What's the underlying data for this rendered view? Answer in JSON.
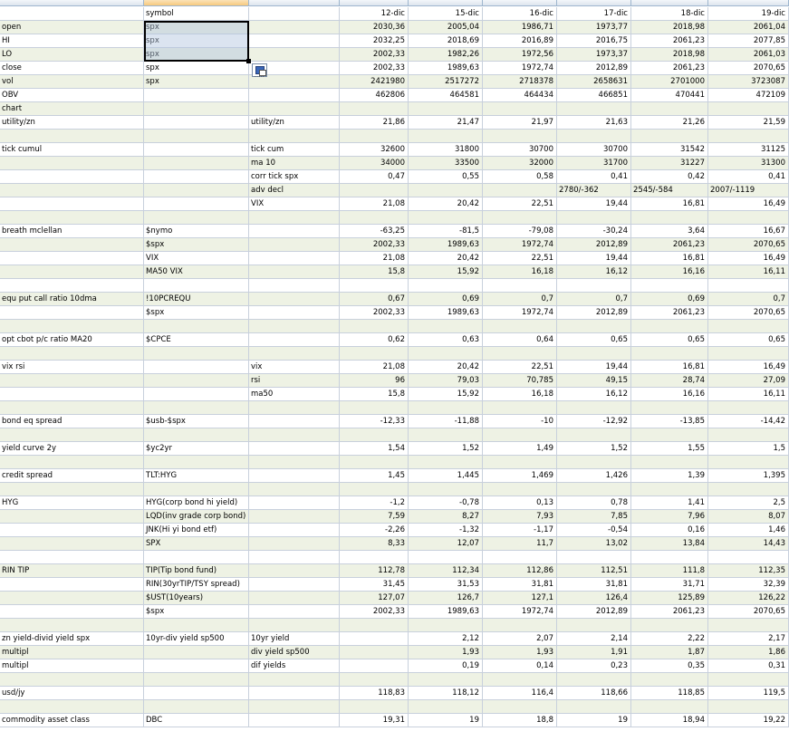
{
  "headers": {
    "symbol": "symbol",
    "dates": [
      "12-dic",
      "15-dic",
      "16-dic",
      "17-dic",
      "18-dic",
      "19-dic"
    ]
  },
  "rows": [
    [
      "open",
      "spx",
      "",
      "2030,36",
      "2005,04",
      "1986,71",
      "1973,77",
      "2018,98",
      "2061,04"
    ],
    [
      "HI",
      "spx",
      "",
      "2032,25",
      "2018,69",
      "2016,89",
      "2016,75",
      "2061,23",
      "2077,85"
    ],
    [
      "LO",
      "spx",
      "",
      "2002,33",
      "1982,26",
      "1972,56",
      "1973,37",
      "2018,98",
      "2061,03"
    ],
    [
      "close",
      "spx",
      "",
      "2002,33",
      "1989,63",
      "1972,74",
      "2012,89",
      "2061,23",
      "2070,65"
    ],
    [
      "vol",
      "spx",
      "",
      "2421980",
      "2517272",
      "2718378",
      "2658631",
      "2701000",
      "3723087"
    ],
    [
      "OBV",
      "",
      "",
      "462806",
      "464581",
      "464434",
      "466851",
      "470441",
      "472109"
    ],
    [
      "chart",
      "",
      "",
      "",
      "",
      "",
      "",
      "",
      ""
    ],
    [
      "utility/zn",
      "",
      "utility/zn",
      "21,86",
      "21,47",
      "21,97",
      "21,63",
      "21,26",
      "21,59"
    ],
    [
      "",
      "",
      "",
      "",
      "",
      "",
      "",
      "",
      ""
    ],
    [
      "tick cumul",
      "",
      "tick cum",
      "32600",
      "31800",
      "30700",
      "30700",
      "31542",
      "31125"
    ],
    [
      "",
      "",
      "ma 10",
      "34000",
      "33500",
      "32000",
      "31700",
      "31227",
      "31300"
    ],
    [
      "",
      "",
      "corr tick spx",
      "0,47",
      "0,55",
      "0,58",
      "0,41",
      "0,42",
      "0,41"
    ],
    [
      "",
      "",
      "adv decl",
      "",
      "",
      "",
      "2780/-362",
      "2545/-584",
      "2007/-1119"
    ],
    [
      "",
      "",
      "VIX",
      "21,08",
      "20,42",
      "22,51",
      "19,44",
      "16,81",
      "16,49"
    ],
    [
      "",
      "",
      "",
      "",
      "",
      "",
      "",
      "",
      ""
    ],
    [
      "breath mclellan",
      "$nymo",
      "",
      "-63,25",
      "-81,5",
      "-79,08",
      "-30,24",
      "3,64",
      "16,67"
    ],
    [
      "",
      "$spx",
      "",
      "2002,33",
      "1989,63",
      "1972,74",
      "2012,89",
      "2061,23",
      "2070,65"
    ],
    [
      "",
      "VIX",
      "",
      "21,08",
      "20,42",
      "22,51",
      "19,44",
      "16,81",
      "16,49"
    ],
    [
      "",
      "MA50 VIX",
      "",
      "15,8",
      "15,92",
      "16,18",
      "16,12",
      "16,16",
      "16,11"
    ],
    [
      "",
      "",
      "",
      "",
      "",
      "",
      "",
      "",
      ""
    ],
    [
      "equ put call ratio 10dma",
      "!10PCREQU",
      "",
      "0,67",
      "0,69",
      "0,7",
      "0,7",
      "0,69",
      "0,7"
    ],
    [
      "",
      "$spx",
      "",
      "2002,33",
      "1989,63",
      "1972,74",
      "2012,89",
      "2061,23",
      "2070,65"
    ],
    [
      "",
      "",
      "",
      "",
      "",
      "",
      "",
      "",
      ""
    ],
    [
      "opt cbot p/c ratio MA20",
      "$CPCE",
      "",
      "0,62",
      "0,63",
      "0,64",
      "0,65",
      "0,65",
      "0,65"
    ],
    [
      "",
      "",
      "",
      "",
      "",
      "",
      "",
      "",
      ""
    ],
    [
      "vix rsi",
      "",
      "vix",
      "21,08",
      "20,42",
      "22,51",
      "19,44",
      "16,81",
      "16,49"
    ],
    [
      "",
      "",
      "rsi",
      "96",
      "79,03",
      "70,785",
      "49,15",
      "28,74",
      "27,09"
    ],
    [
      "",
      "",
      "ma50",
      "15,8",
      "15,92",
      "16,18",
      "16,12",
      "16,16",
      "16,11"
    ],
    [
      "",
      "",
      "",
      "",
      "",
      "",
      "",
      "",
      ""
    ],
    [
      "bond eq spread",
      "$usb-$spx",
      "",
      "-12,33",
      "-11,88",
      "-10",
      "-12,92",
      "-13,85",
      "-14,42"
    ],
    [
      "",
      "",
      "",
      "",
      "",
      "",
      "",
      "",
      ""
    ],
    [
      "yield curve 2y",
      "$yc2yr",
      "",
      "1,54",
      "1,52",
      "1,49",
      "1,52",
      "1,55",
      "1,5"
    ],
    [
      "",
      "",
      "",
      "",
      "",
      "",
      "",
      "",
      ""
    ],
    [
      "credit spread",
      "TLT:HYG",
      "",
      "1,45",
      "1,445",
      "1,469",
      "1,426",
      "1,39",
      "1,395"
    ],
    [
      "",
      "",
      "",
      "",
      "",
      "",
      "",
      "",
      ""
    ],
    [
      "HYG",
      "HYG(corp bond hi yield)",
      "",
      "-1,2",
      "-0,78",
      "0,13",
      "0,78",
      "1,41",
      "2,5"
    ],
    [
      "",
      "LQD(inv grade corp bond)",
      "",
      "7,59",
      "8,27",
      "7,93",
      "7,85",
      "7,96",
      "8,07"
    ],
    [
      "",
      "JNK(Hi yi bond etf)",
      "",
      "-2,26",
      "-1,32",
      "-1,17",
      "-0,54",
      "0,16",
      "1,46"
    ],
    [
      "",
      "SPX",
      "",
      "8,33",
      "12,07",
      "11,7",
      "13,02",
      "13,84",
      "14,43"
    ],
    [
      "",
      "",
      "",
      "",
      "",
      "",
      "",
      "",
      ""
    ],
    [
      "RIN TIP",
      "TIP(Tip bond fund)",
      "",
      "112,78",
      "112,34",
      "112,86",
      "112,51",
      "111,8",
      "112,35"
    ],
    [
      "",
      "RIN(30yrTIP/TSY spread)",
      "",
      "31,45",
      "31,53",
      "31,81",
      "31,81",
      "31,71",
      "32,39"
    ],
    [
      "",
      "$UST(10years)",
      "",
      "127,07",
      "126,7",
      "127,1",
      "126,4",
      "125,89",
      "126,22"
    ],
    [
      "",
      "$spx",
      "",
      "2002,33",
      "1989,63",
      "1972,74",
      "2012,89",
      "2061,23",
      "2070,65"
    ],
    [
      "",
      "",
      "",
      "",
      "",
      "",
      "",
      "",
      ""
    ],
    [
      "zn yield-divid yield spx",
      "10yr-div yield sp500",
      "10yr yield",
      "2,12",
      "2,07",
      "2,14",
      "2,22",
      "2,17"
    ],
    [
      "multipl",
      "",
      "div yield sp500",
      "1,93",
      "1,93",
      "1,91",
      "1,87",
      "1,86"
    ],
    [
      "multipl",
      "",
      "dif yields",
      "0,19",
      "0,14",
      "0,23",
      "0,35",
      "0,31"
    ],
    [
      "",
      "",
      "",
      "",
      "",
      "",
      "",
      "",
      ""
    ],
    [
      "usd/jy",
      "",
      "",
      "118,83",
      "118,12",
      "116,4",
      "118,66",
      "118,85",
      "119,5"
    ],
    [
      "",
      "",
      "",
      "",
      "",
      "",
      "",
      "",
      ""
    ],
    [
      "commodity asset class",
      "DBC",
      "",
      "19,31",
      "19",
      "18,8",
      "19",
      "18,94",
      "19,22"
    ]
  ],
  "colors": {
    "band": "#eef2e4",
    "grid": "#c8d0dc",
    "selection": "#b0c4de",
    "header": "#dde4ee"
  },
  "icons": {
    "paste_options": "paste-options-icon"
  }
}
